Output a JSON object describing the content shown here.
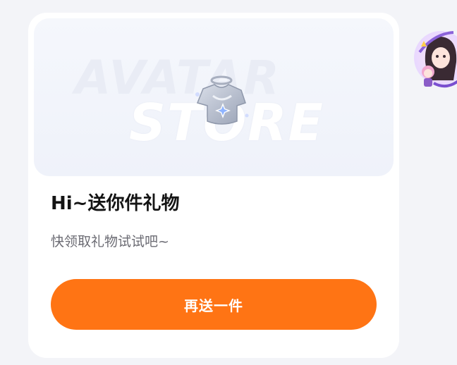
{
  "banner": {
    "watermark_line1": "AVATAR",
    "watermark_line2": "STORE",
    "gift_icon": "sparkling-clothing-icon"
  },
  "gift_card": {
    "title": "Hi~送你件礼物",
    "subtitle": "快领取礼物试试吧~",
    "cta_label": "再送一件"
  },
  "side_avatar": {
    "icon": "anime-avatar-icon"
  },
  "colors": {
    "page_bg": "#f3f4f8",
    "card_bg": "#ffffff",
    "accent": "#ff7414",
    "title_text": "#141414",
    "subtitle_text": "#6b6b73"
  }
}
